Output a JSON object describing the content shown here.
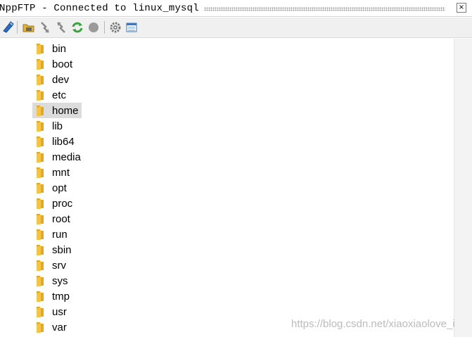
{
  "window": {
    "title": "NppFTP - Connected to linux_mysql",
    "close_glyph": "×"
  },
  "toolbar": {
    "buttons": [
      {
        "name": "connect-icon",
        "color": "#2b6cc4"
      },
      {
        "name": "open-folder-icon",
        "color": "#e2b33a"
      },
      {
        "name": "download-icon",
        "color": "#8a8a8a"
      },
      {
        "name": "upload-icon",
        "color": "#8a8a8a"
      },
      {
        "name": "refresh-icon",
        "color": "#3aa33a"
      },
      {
        "name": "abort-icon",
        "color": "#9a9a9a"
      },
      {
        "name": "settings-icon",
        "color": "#7a7a7a"
      },
      {
        "name": "message-window-icon",
        "color": "#3a78c8"
      }
    ]
  },
  "tree": {
    "selected": "home",
    "folder_color": "#f5c542",
    "items": [
      "bin",
      "boot",
      "dev",
      "etc",
      "home",
      "lib",
      "lib64",
      "media",
      "mnt",
      "opt",
      "proc",
      "root",
      "run",
      "sbin",
      "srv",
      "sys",
      "tmp",
      "usr",
      "var"
    ]
  },
  "watermark": "https://blog.csdn.net/xiaoxiaolove_i"
}
